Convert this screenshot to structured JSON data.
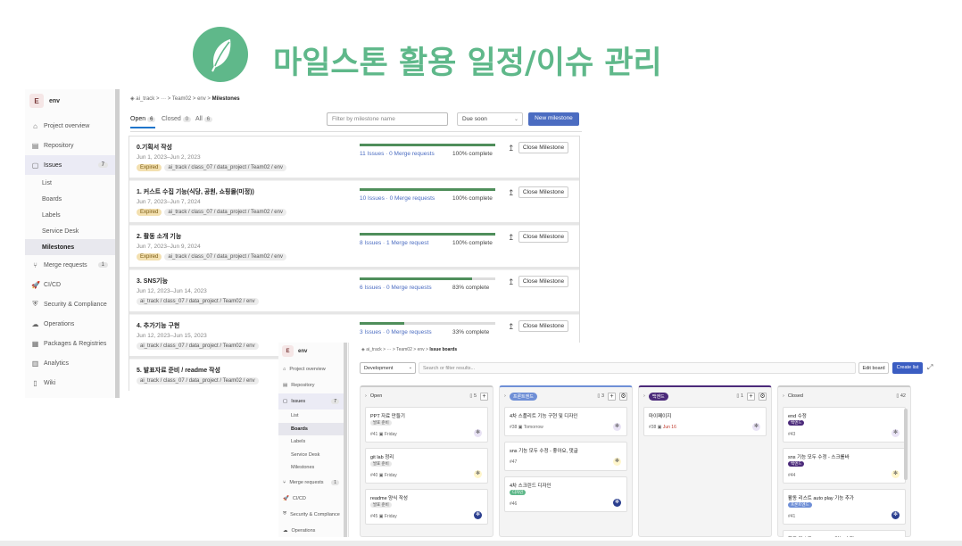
{
  "header": {
    "title": "마일스톤 활용 일정/이슈 관리",
    "logo_color": "#5fb88a"
  },
  "screen1": {
    "project": {
      "initial": "E",
      "name": "env"
    },
    "nav": [
      {
        "icon": "⌂",
        "label": "Project overview"
      },
      {
        "icon": "▤",
        "label": "Repository"
      },
      {
        "icon": "▢",
        "label": "Issues",
        "badge": "7",
        "active": true
      },
      {
        "icon": "⑂",
        "label": "Merge requests",
        "badge": "1"
      },
      {
        "icon": "🚀",
        "label": "CI/CD"
      },
      {
        "icon": "⛨",
        "label": "Security & Compliance"
      },
      {
        "icon": "☁",
        "label": "Operations"
      },
      {
        "icon": "▦",
        "label": "Packages & Registries"
      },
      {
        "icon": "▥",
        "label": "Analytics"
      },
      {
        "icon": "▯",
        "label": "Wiki"
      }
    ],
    "issue_sub": [
      "List",
      "Boards",
      "Labels",
      "Service Desk",
      "Milestones"
    ],
    "breadcrumb": {
      "a": "ai_track",
      "dots": "···",
      "b": "Team02",
      "c": "env",
      "d": "Milestones"
    },
    "tabs": [
      {
        "label": "Open",
        "count": "6"
      },
      {
        "label": "Closed",
        "count": "0"
      },
      {
        "label": "All",
        "count": "6"
      }
    ],
    "filter_placeholder": "Filter by milestone name",
    "sort": "Due soon",
    "new_milestone": "New milestone",
    "milestones": [
      {
        "name": "0.기획서 작성",
        "date": "Jun 1, 2023–Jun 2, 2023",
        "status": "Expired",
        "path": "ai_track / class_07 / data_project / Team02 / env",
        "issues": "11 Issues · 0 Merge requests",
        "percent": 100,
        "pct_label": "100% complete",
        "close": "Close Milestone"
      },
      {
        "name": "1. 커스트 수집 기능(식당, 공원, 쇼핑몰(미정))",
        "date": "Jun 7, 2023–Jun 7, 2024",
        "status": "Expired",
        "path": "ai_track / class_07 / data_project / Team02 / env",
        "issues": "10 Issues · 0 Merge requests",
        "percent": 100,
        "pct_label": "100% complete",
        "close": "Close Milestone"
      },
      {
        "name": "2. 활동 소개 기능",
        "date": "Jun 7, 2023–Jun 9, 2024",
        "status": "Expired",
        "path": "ai_track / class_07 / data_project / Team02 / env",
        "issues": "8 Issues · 1 Merge request",
        "percent": 100,
        "pct_label": "100% complete",
        "close": "Close Milestone"
      },
      {
        "name": "3. SNS기능",
        "date": "Jun 12, 2023–Jun 14, 2023",
        "status": "",
        "path": "ai_track / class_07 / data_project / Team02 / env",
        "issues": "6 Issues · 0 Merge requests",
        "percent": 83,
        "pct_label": "83% complete",
        "close": "Close Milestone"
      },
      {
        "name": "4. 추가기능 구현",
        "date": "Jun 12, 2023–Jun 15, 2023",
        "status": "",
        "path": "ai_track / class_07 / data_project / Team02 / env",
        "issues": "3 Issues · 0 Merge requests",
        "percent": 33,
        "pct_label": "33% complete",
        "close": "Close Milestone"
      },
      {
        "name": "5. 발표자료 준비 / readme 작성",
        "date": "",
        "status": "",
        "path": "ai_track / class_07 / data_project / Team02 / env",
        "issues": "",
        "percent": 0,
        "pct_label": "",
        "close": ""
      }
    ]
  },
  "screen2": {
    "project": {
      "initial": "E",
      "name": "env"
    },
    "nav": [
      {
        "icon": "⌂",
        "label": "Project overview"
      },
      {
        "icon": "▤",
        "label": "Repository"
      },
      {
        "icon": "▢",
        "label": "Issues",
        "badge": "7",
        "active": true
      },
      {
        "icon": "⑂",
        "label": "Merge requests",
        "badge": "1"
      },
      {
        "icon": "🚀",
        "label": "CI/CD"
      },
      {
        "icon": "⛨",
        "label": "Security & Compliance"
      },
      {
        "icon": "☁",
        "label": "Operations"
      }
    ],
    "issue_sub": [
      "List",
      "Boards",
      "Labels",
      "Service Desk",
      "Milestones"
    ],
    "breadcrumb": {
      "a": "ai_track",
      "dots": "···",
      "b": "Team02",
      "c": "env",
      "d": "Issue boards"
    },
    "board": "Development",
    "search_placeholder": "Search or filter results...",
    "edit_board": "Edit board",
    "create_list": "Create list",
    "lists": [
      {
        "title": "Open",
        "label": "",
        "label_color": "",
        "count": "5",
        "cards": [
          {
            "title": "PPT 자료 만들기",
            "label": "발표 준비",
            "label_color": "#e8e8e8",
            "id": "#41",
            "due": "Friday",
            "due_red": false
          },
          {
            "title": "git lab 정리",
            "label": "발표 준비",
            "label_color": "#e8e8e8",
            "id": "#40",
            "due": "Friday",
            "due_red": false
          },
          {
            "title": "readme 양식 작성",
            "label": "발표 준비",
            "label_color": "#e8e8e8",
            "id": "#45",
            "due": "Friday",
            "due_red": false
          }
        ]
      },
      {
        "title": "",
        "label": "프론트엔드",
        "label_color": "#6f8fd6",
        "count": "3",
        "cards": [
          {
            "title": "4차 스플리트 기능 구현 및 디자인",
            "label": "",
            "label_color": "",
            "id": "#38",
            "due": "Tomorrow",
            "due_red": false
          },
          {
            "title": "sns 기능 모두 수정 - 좋아요, 댓글",
            "label": "",
            "label_color": "",
            "id": "#47",
            "due": "",
            "due_red": false
          },
          {
            "title": "4차 스크린드 디자인",
            "label": "디자인",
            "label_color": "#5fb88a",
            "id": "#46",
            "due": "",
            "due_red": false
          }
        ]
      },
      {
        "title": "",
        "label": "백엔드",
        "label_color": "#4b2a7a",
        "count": "1",
        "cards": [
          {
            "title": "마이페이지",
            "label": "",
            "label_color": "",
            "id": "#38",
            "due": "Jun 16",
            "due_red": true
          }
        ]
      },
      {
        "title": "Closed",
        "label": "",
        "label_color": "",
        "count": "42",
        "cards": [
          {
            "title": "end 수정",
            "label": "백엔드",
            "label_color": "#4b2a7a",
            "id": "#43",
            "due": "",
            "due_red": false
          },
          {
            "title": "sns 기능 모두 수정 - 스크롤바",
            "label": "백엔드",
            "label_color": "#4b2a7a",
            "id": "#44",
            "due": "",
            "due_red": false
          },
          {
            "title": "활동 리스트 auto play 기능 추가",
            "label": "프론트엔드",
            "label_color": "#6f8fd6",
            "id": "#41",
            "due": "",
            "due_red": false
          },
          {
            "title": "활동 리스트 auto play 기능 수정",
            "label": "백엔드",
            "label_color": "#4b2a7a",
            "id": "",
            "due": "",
            "due_red": false
          }
        ]
      }
    ]
  }
}
